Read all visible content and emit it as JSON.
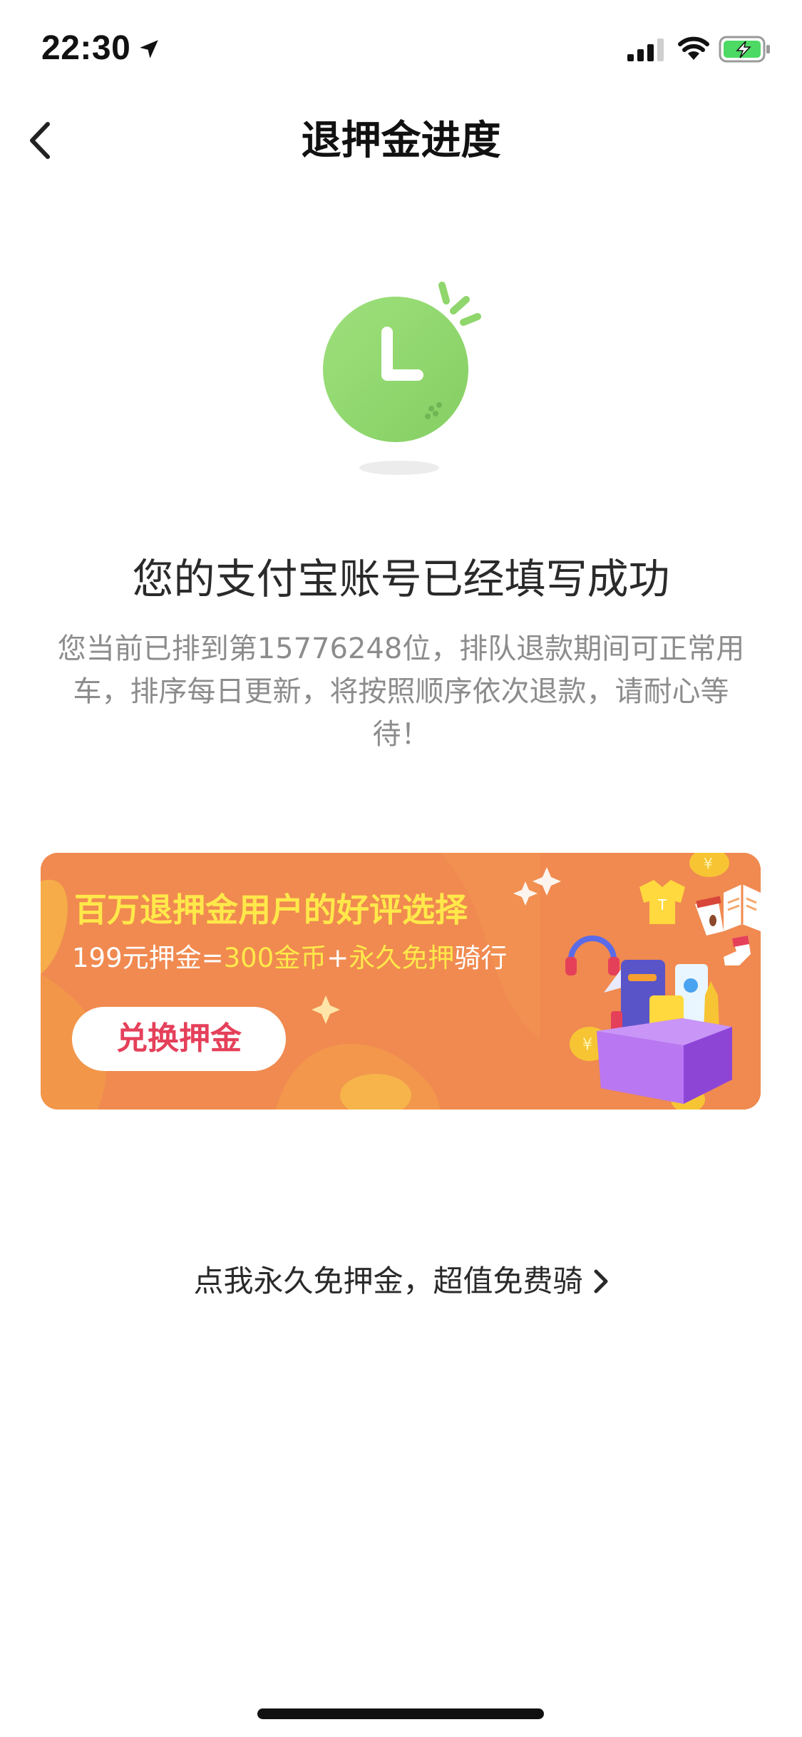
{
  "status_bar": {
    "time": "22:30",
    "icons": [
      "location-arrow-icon",
      "cellular-signal-icon",
      "wifi-icon",
      "battery-charging-icon"
    ]
  },
  "nav": {
    "back_icon": "chevron-left-icon",
    "title": "退押金进度"
  },
  "status": {
    "illustration_icon": "clock-icon",
    "title": "您的支付宝账号已经填写成功",
    "description": "您当前已排到第15776248位，排队退款期间可正常用车，排序每日更新，将按照顺序依次退款，请耐心等待！"
  },
  "promo": {
    "headline": "百万退押金用户的好评选择",
    "subline_part1": "199元押金=",
    "subline_part2": "300金币",
    "subline_part3": "+",
    "subline_part4": "永久免押",
    "subline_part5": "骑行",
    "button_label": "兑换押金",
    "colors": {
      "background": "#f08a50",
      "highlight": "#ffe84a",
      "button_text": "#e5405a"
    }
  },
  "free_deposit": {
    "label": "点我永久免押金，超值免费骑",
    "chevron_icon": "chevron-right-icon"
  },
  "colors": {
    "accent_green": "#8fd66c",
    "text_dark": "#2a2a2a",
    "text_muted": "#8c8c8c"
  }
}
